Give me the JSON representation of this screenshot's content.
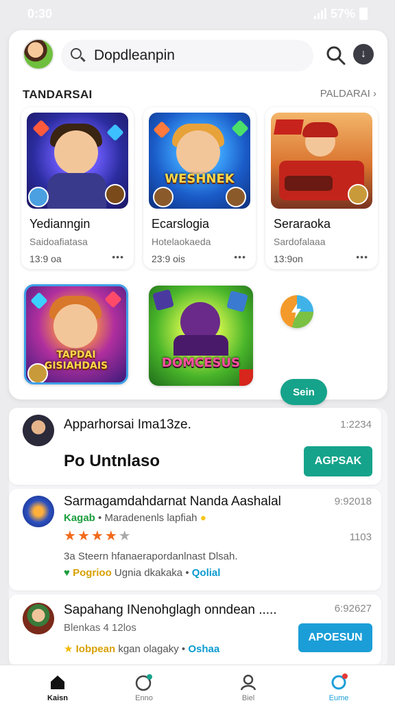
{
  "status": {
    "time": "0:30",
    "battery": "57%"
  },
  "search": {
    "value": "Dopdleanpin"
  },
  "section": {
    "title": "TANDARSAI",
    "link": "PALDARAI ›"
  },
  "apps": [
    {
      "name": "Yedianngin",
      "subtitle": "Saidoafiatasa",
      "size": "13:9 oa",
      "art_text": ""
    },
    {
      "name": "Ecarslogia",
      "subtitle": "Hotelaokaeda",
      "size": "23:9 ois",
      "art_text": "WESHNEK"
    },
    {
      "name": "Seraraoka",
      "subtitle": "Sardofalaaa",
      "size": "13:9on",
      "art_text": ""
    }
  ],
  "featured": [
    {
      "art_text": "TAPDAI GISIAHDAIS"
    },
    {
      "art_text": "DOMCESUS"
    }
  ],
  "mini_button": "Sein",
  "feed": [
    {
      "title": "Apparhorsai Ima13ze.",
      "time": "1:2234",
      "subtitle": "Po Untnlaso",
      "button": "AGPSAK"
    },
    {
      "title": "Sarmagamdahdarnat Nanda Aashalal",
      "time": "9:92018",
      "developer": "Kagab",
      "category": "Maradenenls lapfiah",
      "rating": 4,
      "count": "1103",
      "desc": "3a Steern hfanaerapordanlnast Dlsah.",
      "tag1": "Pogrioo",
      "tag2": "Ugnia dkakaka",
      "tag3": "Qolial"
    },
    {
      "title": "Sapahang INenohglagh onndean .....",
      "time": "6:92627",
      "subtitle": "Blenkas 4 12los",
      "tag1": "Iobpean",
      "tag2": "kgan olagaky",
      "tag3": "Oshaa",
      "button": "APOESUN"
    }
  ],
  "nav": [
    {
      "label": "Kaisn"
    },
    {
      "label": "Enno"
    },
    {
      "label": "Biel"
    },
    {
      "label": "Eume"
    }
  ],
  "colors": {
    "accent": "#16a38b",
    "blue": "#1b9ed8",
    "star": "#f26a1b"
  }
}
